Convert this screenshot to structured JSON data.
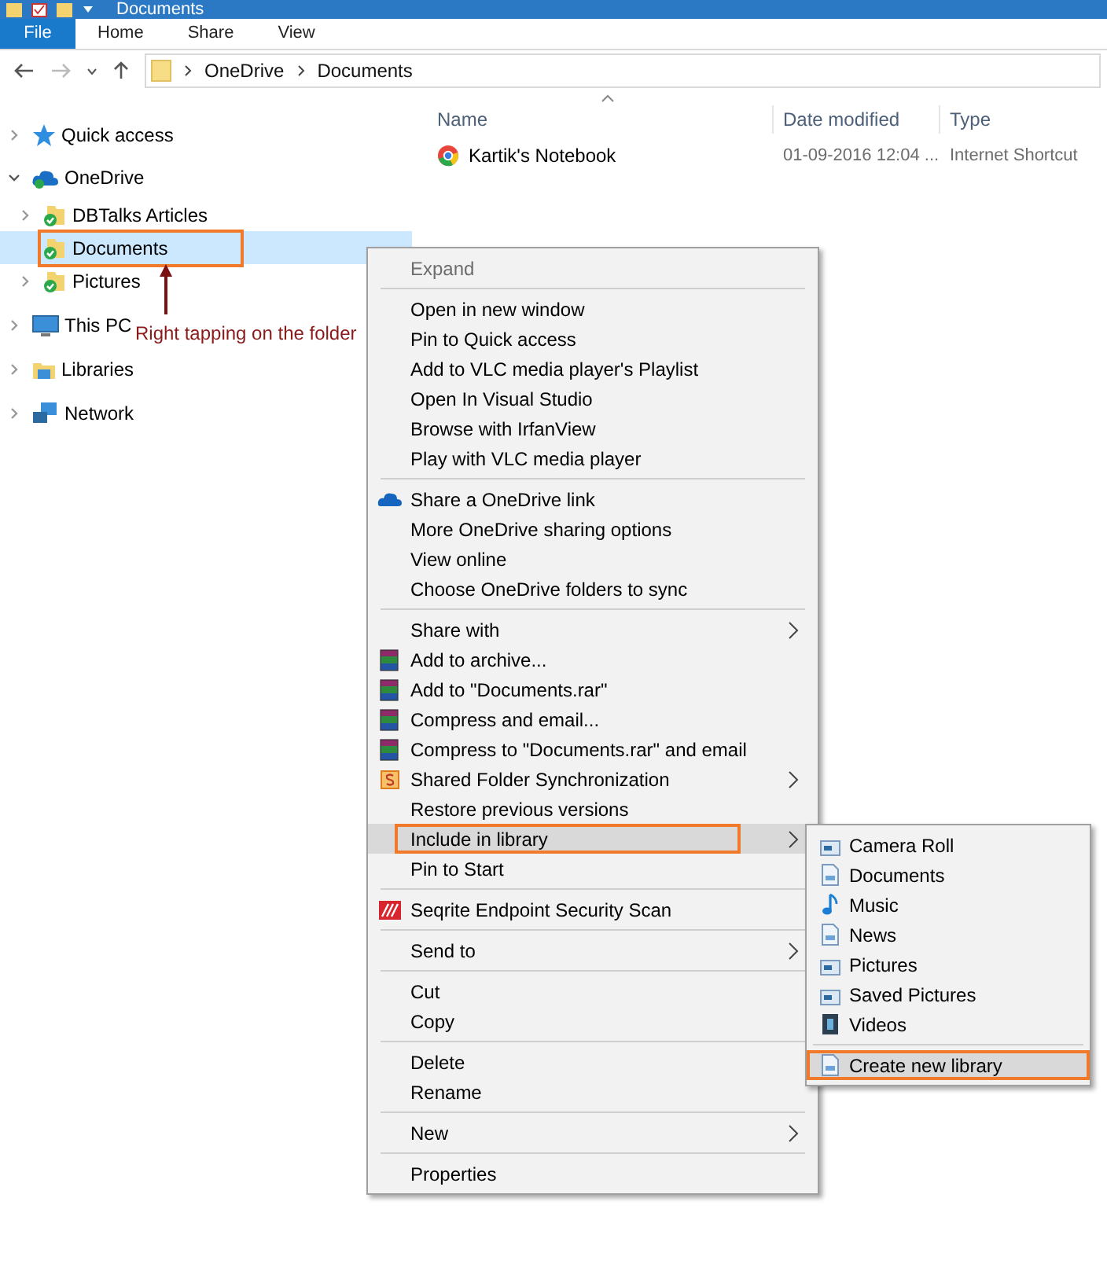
{
  "window": {
    "title": "Documents"
  },
  "ribbon_tabs": [
    {
      "label": "File",
      "kind": "file"
    },
    {
      "label": "Home",
      "kind": "tab"
    },
    {
      "label": "Share",
      "kind": "tab"
    },
    {
      "label": "View",
      "kind": "tab"
    }
  ],
  "address_bar": {
    "path": [
      "OneDrive",
      "Documents"
    ]
  },
  "nav": {
    "items": [
      {
        "label": "Quick access",
        "kind": "star",
        "expandable": true,
        "expanded": false,
        "selected": false,
        "annotated": false
      },
      {
        "label": "OneDrive",
        "kind": "cloud",
        "expandable": true,
        "expanded": true,
        "selected": false,
        "annotated": false,
        "children": [
          {
            "label": "DBTalks Articles",
            "kind": "synced-folder",
            "expandable": true,
            "expanded": false,
            "selected": false,
            "annotated": false
          },
          {
            "label": "Documents",
            "kind": "synced-folder",
            "expandable": false,
            "selected": true,
            "annotated": true
          },
          {
            "label": "Pictures",
            "kind": "synced-folder",
            "expandable": true,
            "expanded": false,
            "selected": false,
            "annotated": false
          }
        ]
      },
      {
        "label": "This PC",
        "kind": "pc",
        "expandable": true,
        "expanded": false,
        "selected": false,
        "annotated": false
      },
      {
        "label": "Libraries",
        "kind": "library",
        "expandable": true,
        "expanded": false,
        "selected": false,
        "annotated": false
      },
      {
        "label": "Network",
        "kind": "network",
        "expandable": true,
        "expanded": false,
        "selected": false,
        "annotated": false
      }
    ]
  },
  "annotation": {
    "text": "Right tapping on the folder"
  },
  "table": {
    "columns": [
      "Name",
      "Date modified",
      "Type"
    ],
    "rows": [
      {
        "name": "Kartik's Notebook",
        "date": "01-09-2016 12:04 ...",
        "type": "Internet Shortcut"
      }
    ]
  },
  "context_menu": {
    "groups": [
      [
        {
          "label": "Expand",
          "kind": "plain",
          "disabled": true,
          "has_submenu": false,
          "selected": false,
          "annotated": false
        }
      ],
      [
        {
          "label": "Open in new window",
          "kind": "plain",
          "disabled": false,
          "has_submenu": false,
          "selected": false,
          "annotated": false
        },
        {
          "label": "Pin to Quick access",
          "kind": "plain",
          "disabled": false,
          "has_submenu": false,
          "selected": false,
          "annotated": false
        },
        {
          "label": "Add to VLC media player's Playlist",
          "kind": "plain",
          "disabled": false,
          "has_submenu": false,
          "selected": false,
          "annotated": false
        },
        {
          "label": "Open In Visual Studio",
          "kind": "plain",
          "disabled": false,
          "has_submenu": false,
          "selected": false,
          "annotated": false
        },
        {
          "label": "Browse with IrfanView",
          "kind": "plain",
          "disabled": false,
          "has_submenu": false,
          "selected": false,
          "annotated": false
        },
        {
          "label": "Play with VLC media player",
          "kind": "plain",
          "disabled": false,
          "has_submenu": false,
          "selected": false,
          "annotated": false
        }
      ],
      [
        {
          "label": "Share a OneDrive link",
          "kind": "cloud",
          "disabled": false,
          "has_submenu": false,
          "selected": false,
          "annotated": false
        },
        {
          "label": "More OneDrive sharing options",
          "kind": "plain",
          "disabled": false,
          "has_submenu": false,
          "selected": false,
          "annotated": false
        },
        {
          "label": "View online",
          "kind": "plain",
          "disabled": false,
          "has_submenu": false,
          "selected": false,
          "annotated": false
        },
        {
          "label": "Choose OneDrive folders to sync",
          "kind": "plain",
          "disabled": false,
          "has_submenu": false,
          "selected": false,
          "annotated": false
        }
      ],
      [
        {
          "label": "Share with",
          "kind": "plain",
          "disabled": false,
          "has_submenu": true,
          "selected": false,
          "annotated": false
        },
        {
          "label": "Add to archive...",
          "kind": "archive",
          "disabled": false,
          "has_submenu": false,
          "selected": false,
          "annotated": false
        },
        {
          "label": "Add to \"Documents.rar\"",
          "kind": "archive",
          "disabled": false,
          "has_submenu": false,
          "selected": false,
          "annotated": false
        },
        {
          "label": "Compress and email...",
          "kind": "archive",
          "disabled": false,
          "has_submenu": false,
          "selected": false,
          "annotated": false
        },
        {
          "label": "Compress to \"Documents.rar\" and email",
          "kind": "archive",
          "disabled": false,
          "has_submenu": false,
          "selected": false,
          "annotated": false
        },
        {
          "label": "Shared Folder Synchronization",
          "kind": "sync",
          "disabled": false,
          "has_submenu": true,
          "selected": false,
          "annotated": false
        },
        {
          "label": "Restore previous versions",
          "kind": "plain",
          "disabled": false,
          "has_submenu": false,
          "selected": false,
          "annotated": false
        },
        {
          "label": "Include in library",
          "kind": "plain",
          "disabled": false,
          "has_submenu": true,
          "selected": true,
          "annotated": true
        },
        {
          "label": "Pin to Start",
          "kind": "plain",
          "disabled": false,
          "has_submenu": false,
          "selected": false,
          "annotated": false
        }
      ],
      [
        {
          "label": "Seqrite Endpoint Security Scan",
          "kind": "shield",
          "disabled": false,
          "has_submenu": false,
          "selected": false,
          "annotated": false
        }
      ],
      [
        {
          "label": "Send to",
          "kind": "plain",
          "disabled": false,
          "has_submenu": true,
          "selected": false,
          "annotated": false
        }
      ],
      [
        {
          "label": "Cut",
          "kind": "plain",
          "disabled": false,
          "has_submenu": false,
          "selected": false,
          "annotated": false
        },
        {
          "label": "Copy",
          "kind": "plain",
          "disabled": false,
          "has_submenu": false,
          "selected": false,
          "annotated": false
        }
      ],
      [
        {
          "label": "Delete",
          "kind": "plain",
          "disabled": false,
          "has_submenu": false,
          "selected": false,
          "annotated": false
        },
        {
          "label": "Rename",
          "kind": "plain",
          "disabled": false,
          "has_submenu": false,
          "selected": false,
          "annotated": false
        }
      ],
      [
        {
          "label": "New",
          "kind": "plain",
          "disabled": false,
          "has_submenu": true,
          "selected": false,
          "annotated": false
        }
      ],
      [
        {
          "label": "Properties",
          "kind": "plain",
          "disabled": false,
          "has_submenu": false,
          "selected": false,
          "annotated": false
        }
      ]
    ]
  },
  "submenu": {
    "groups": [
      [
        {
          "label": "Camera Roll",
          "kind": "library",
          "selected": false,
          "annotated": false
        },
        {
          "label": "Documents",
          "kind": "document",
          "selected": false,
          "annotated": false
        },
        {
          "label": "Music",
          "kind": "music",
          "selected": false,
          "annotated": false
        },
        {
          "label": "News",
          "kind": "document",
          "selected": false,
          "annotated": false
        },
        {
          "label": "Pictures",
          "kind": "library",
          "selected": false,
          "annotated": false
        },
        {
          "label": "Saved Pictures",
          "kind": "library",
          "selected": false,
          "annotated": false
        },
        {
          "label": "Videos",
          "kind": "film",
          "selected": false,
          "annotated": false
        }
      ],
      [
        {
          "label": "Create new library",
          "kind": "document",
          "selected": true,
          "annotated": true
        }
      ]
    ]
  }
}
